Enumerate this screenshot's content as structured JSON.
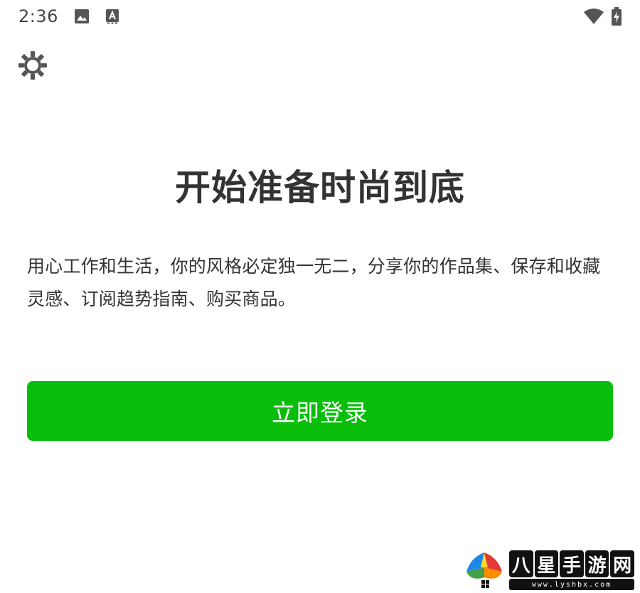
{
  "status_bar": {
    "time": "2:36",
    "icons": [
      "image-icon",
      "text-a-icon",
      "wifi-icon",
      "battery-charging-icon"
    ]
  },
  "settings": {
    "icon": "gear-icon"
  },
  "headline": "开始准备时尚到底",
  "description": "用心工作和生活，你的风格必定独一无二，分享你的作品集、保存和收藏灵感、订阅趋势指南、购买商品。",
  "login_button": {
    "label": "立即登录"
  },
  "watermark": {
    "chars": [
      "八",
      "星",
      "手",
      "游",
      "网"
    ],
    "url": "www.lyshbx.com"
  },
  "colors": {
    "accent": "#08BE0A",
    "text": "#333333",
    "status_icons": "#555555"
  }
}
